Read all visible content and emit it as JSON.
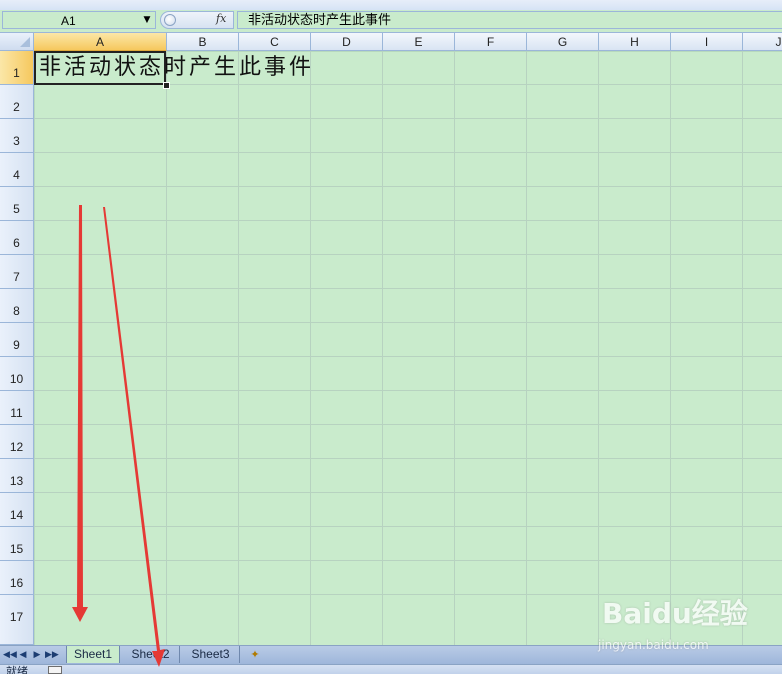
{
  "formula_bar": {
    "name_box": "A1",
    "fx_label": "fx",
    "formula": "非活动状态时产生此事件"
  },
  "sheet": {
    "columns": [
      "A",
      "B",
      "C",
      "D",
      "E",
      "F",
      "G",
      "H",
      "I",
      "J"
    ],
    "rows": [
      "1",
      "2",
      "3",
      "4",
      "5",
      "6",
      "7",
      "8",
      "9",
      "10",
      "11",
      "12",
      "13",
      "14",
      "15",
      "16",
      "17"
    ],
    "active_cell": "A1",
    "cell_a1": "非活动状态时产生此事件",
    "cell_color": "#c9ebcc",
    "active_header_color": "#f6c85e"
  },
  "tabs": {
    "nav": [
      "◀◀",
      "◀",
      "▶",
      "▶▶"
    ],
    "sheets": [
      "Sheet1",
      "Sheet2",
      "Sheet3"
    ],
    "active": "Sheet1"
  },
  "status": {
    "text": "就绪"
  },
  "annotations": {
    "arrow_color": "#e53935"
  },
  "watermark": {
    "brand": "Baidu经验",
    "url": "jingyan.baidu.com"
  }
}
